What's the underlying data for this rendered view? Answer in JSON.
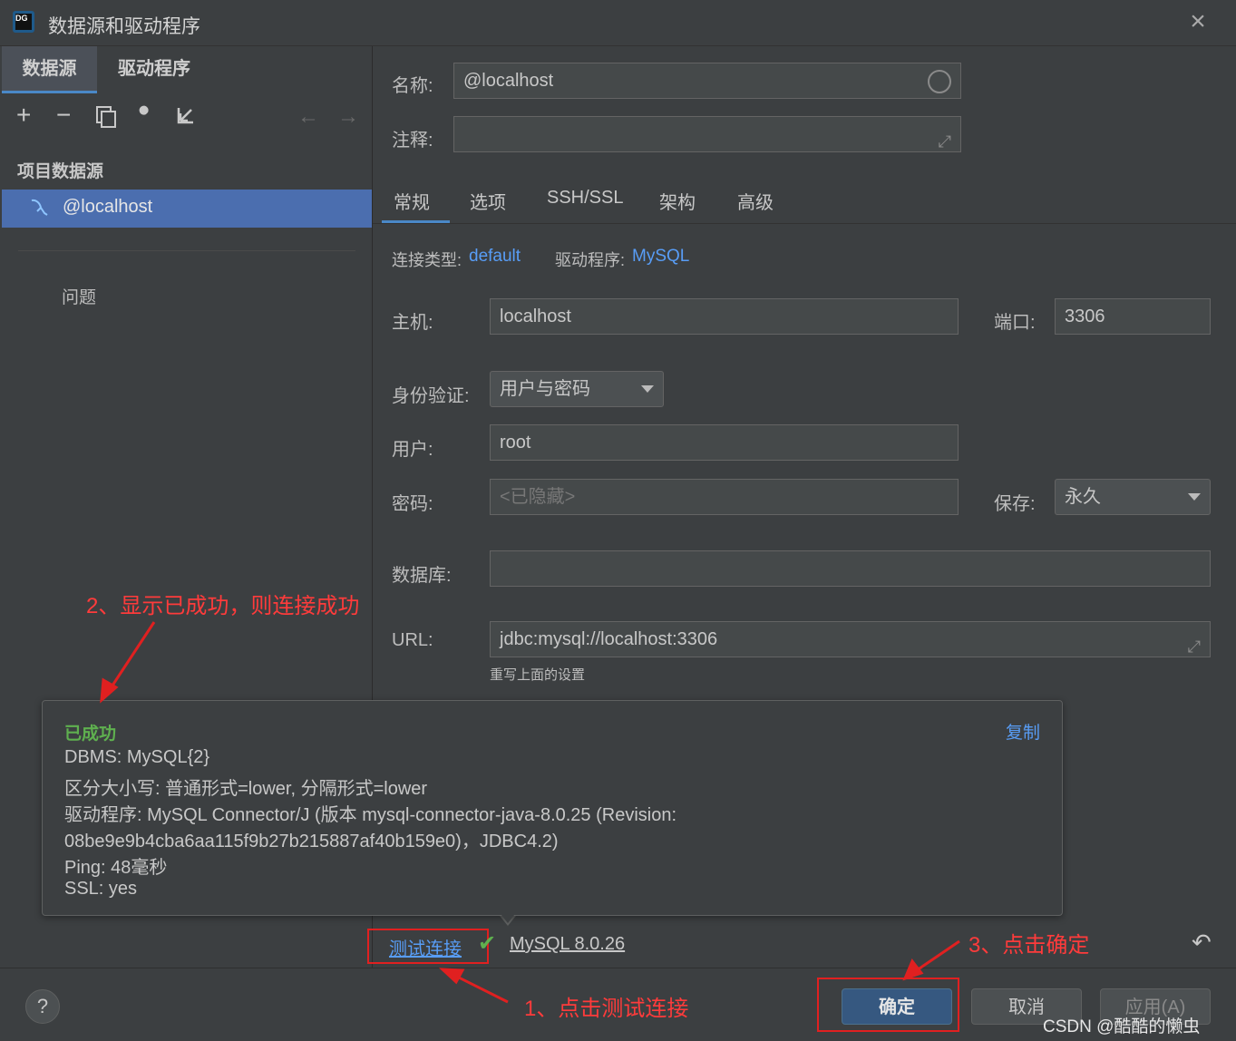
{
  "window": {
    "title": "数据源和驱动程序",
    "logo_text": "DG"
  },
  "left": {
    "tabs": [
      "数据源",
      "驱动程序"
    ],
    "toolbar": {
      "add": "+",
      "remove": "−",
      "copy": "⧉",
      "wrench": "🔧",
      "import": "↙",
      "back": "←",
      "forward": "→"
    },
    "section_title": "项目数据源",
    "datasource": "@localhost",
    "problems": "问题"
  },
  "right": {
    "name_label": "名称:",
    "name_value": "@localhost",
    "comment_label": "注释:",
    "comment_value": "",
    "tabs": [
      "常规",
      "选项",
      "SSH/SSL",
      "架构",
      "高级"
    ],
    "conn_type_label": "连接类型:",
    "conn_type_value": "default",
    "driver_label": "驱动程序:",
    "driver_value": "MySQL",
    "host_label": "主机:",
    "host_value": "localhost",
    "port_label": "端口:",
    "port_value": "3306",
    "auth_label": "身份验证:",
    "auth_value": "用户与密码",
    "user_label": "用户:",
    "user_value": "root",
    "password_label": "密码:",
    "password_placeholder": "<已隐藏>",
    "save_label": "保存:",
    "save_value": "永久",
    "database_label": "数据库:",
    "database_value": "",
    "url_label": "URL:",
    "url_value": "jdbc:mysql://localhost:3306",
    "url_hint": "重写上面的设置"
  },
  "popup": {
    "status": "已成功",
    "copy": "复制",
    "lines": [
      "DBMS: MySQL{2}",
      "区分大小写: 普通形式=lower, 分隔形式=lower",
      "驱动程序: MySQL Connector/J (版本 mysql-connector-java-8.0.25 (Revision:",
      "08be9e9b4cba6aa115f9b27b215887af40b159e0)，JDBC4.2)",
      "Ping: 48毫秒",
      "SSL: yes"
    ]
  },
  "footer": {
    "test_connection": "测试连接",
    "mysql_version": "MySQL 8.0.26",
    "help": "?",
    "ok": "确定",
    "cancel": "取消",
    "apply": "应用(A)",
    "watermark": "CSDN @酷酷的懒虫"
  },
  "annotations": {
    "step1": "1、点击测试连接",
    "step2": "2、显示已成功，则连接成功",
    "step3": "3、点击确定"
  },
  "colors": {
    "accent": "#4a88c7",
    "selection": "#4b6eaf",
    "link": "#589df6",
    "success": "#5fb04f",
    "annotation": "#e02020"
  }
}
